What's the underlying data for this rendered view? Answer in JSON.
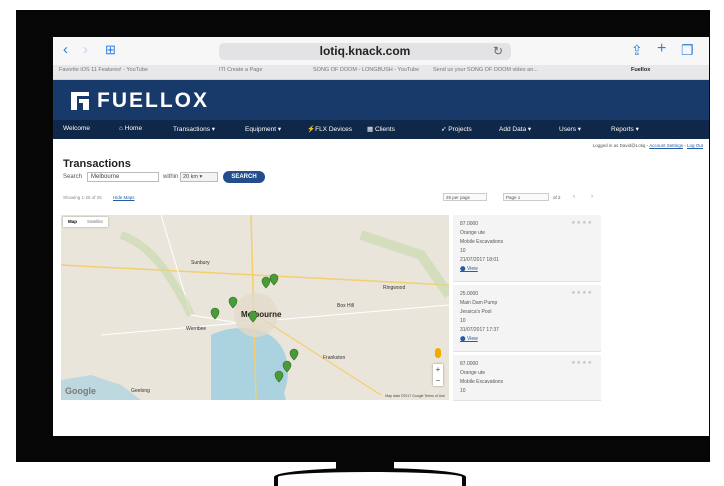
{
  "browser": {
    "url": "lotiq.knack.com",
    "tabs": [
      {
        "label": "Favorite iOS 11 Features! - YouTube",
        "active": false
      },
      {
        "label": "ITI Create a Page",
        "active": false
      },
      {
        "label": "SONG OF DOOM - LONGBUSH - YouTube",
        "active": false
      },
      {
        "label": "Send us your SONG OF DOOM video an...",
        "active": false
      },
      {
        "label": "Fuellox",
        "active": true
      }
    ]
  },
  "app": {
    "brand": "FUELLOX",
    "menu": [
      "Welcome",
      "Home",
      "Transactions",
      "Equipment",
      "FLX Devices",
      "Clients",
      "Projects",
      "Add Data",
      "Users",
      "Reports"
    ],
    "login": {
      "prefix": "Logged in as David@Lotiq",
      "account": "Account Settings",
      "logout": "Log Out"
    }
  },
  "page": {
    "title": "Transactions",
    "search_label": "Search",
    "search_value": "Melbourne",
    "within_label": "within",
    "within_value": "20 km",
    "search_button": "SEARCH",
    "showing": "Showing 1-25 of 25",
    "hide_map": "Hide Maps",
    "per_page": "25 per page",
    "page_sel": "Page 1",
    "of": "of 2"
  },
  "map": {
    "type_map": "Map",
    "type_sat": "Satellite",
    "google": "Google",
    "footer": "Map data ©2017 Google   Terms of Use",
    "labels": [
      "Werribee",
      "Melbourne",
      "Frankston",
      "Box Hill",
      "Ringwood",
      "Geelong",
      "Sunbury"
    ],
    "zoom_in": "+",
    "zoom_out": "−"
  },
  "results": [
    {
      "amount": "87.0000",
      "category": "Orange ute",
      "client": "Mobile Excavations",
      "code": "10",
      "date": "21/07/2017 18:01",
      "view": "View"
    },
    {
      "amount": "25.0000",
      "category": "Main Dam Pump",
      "client": "Jessica's Pool",
      "code": "10",
      "date": "31/07/2017 17:37",
      "view": "View"
    },
    {
      "amount": "87.0000",
      "category": "Orange ute",
      "client": "Mobile Excavations",
      "code": "10",
      "date": "",
      "view": ""
    }
  ],
  "colors": {
    "brand_bar": "#183a6a",
    "menu_bar": "#0f2748",
    "accent": "#224e8c",
    "pin": "#4b9a3a",
    "safari_blue": "#2b7ee0"
  }
}
